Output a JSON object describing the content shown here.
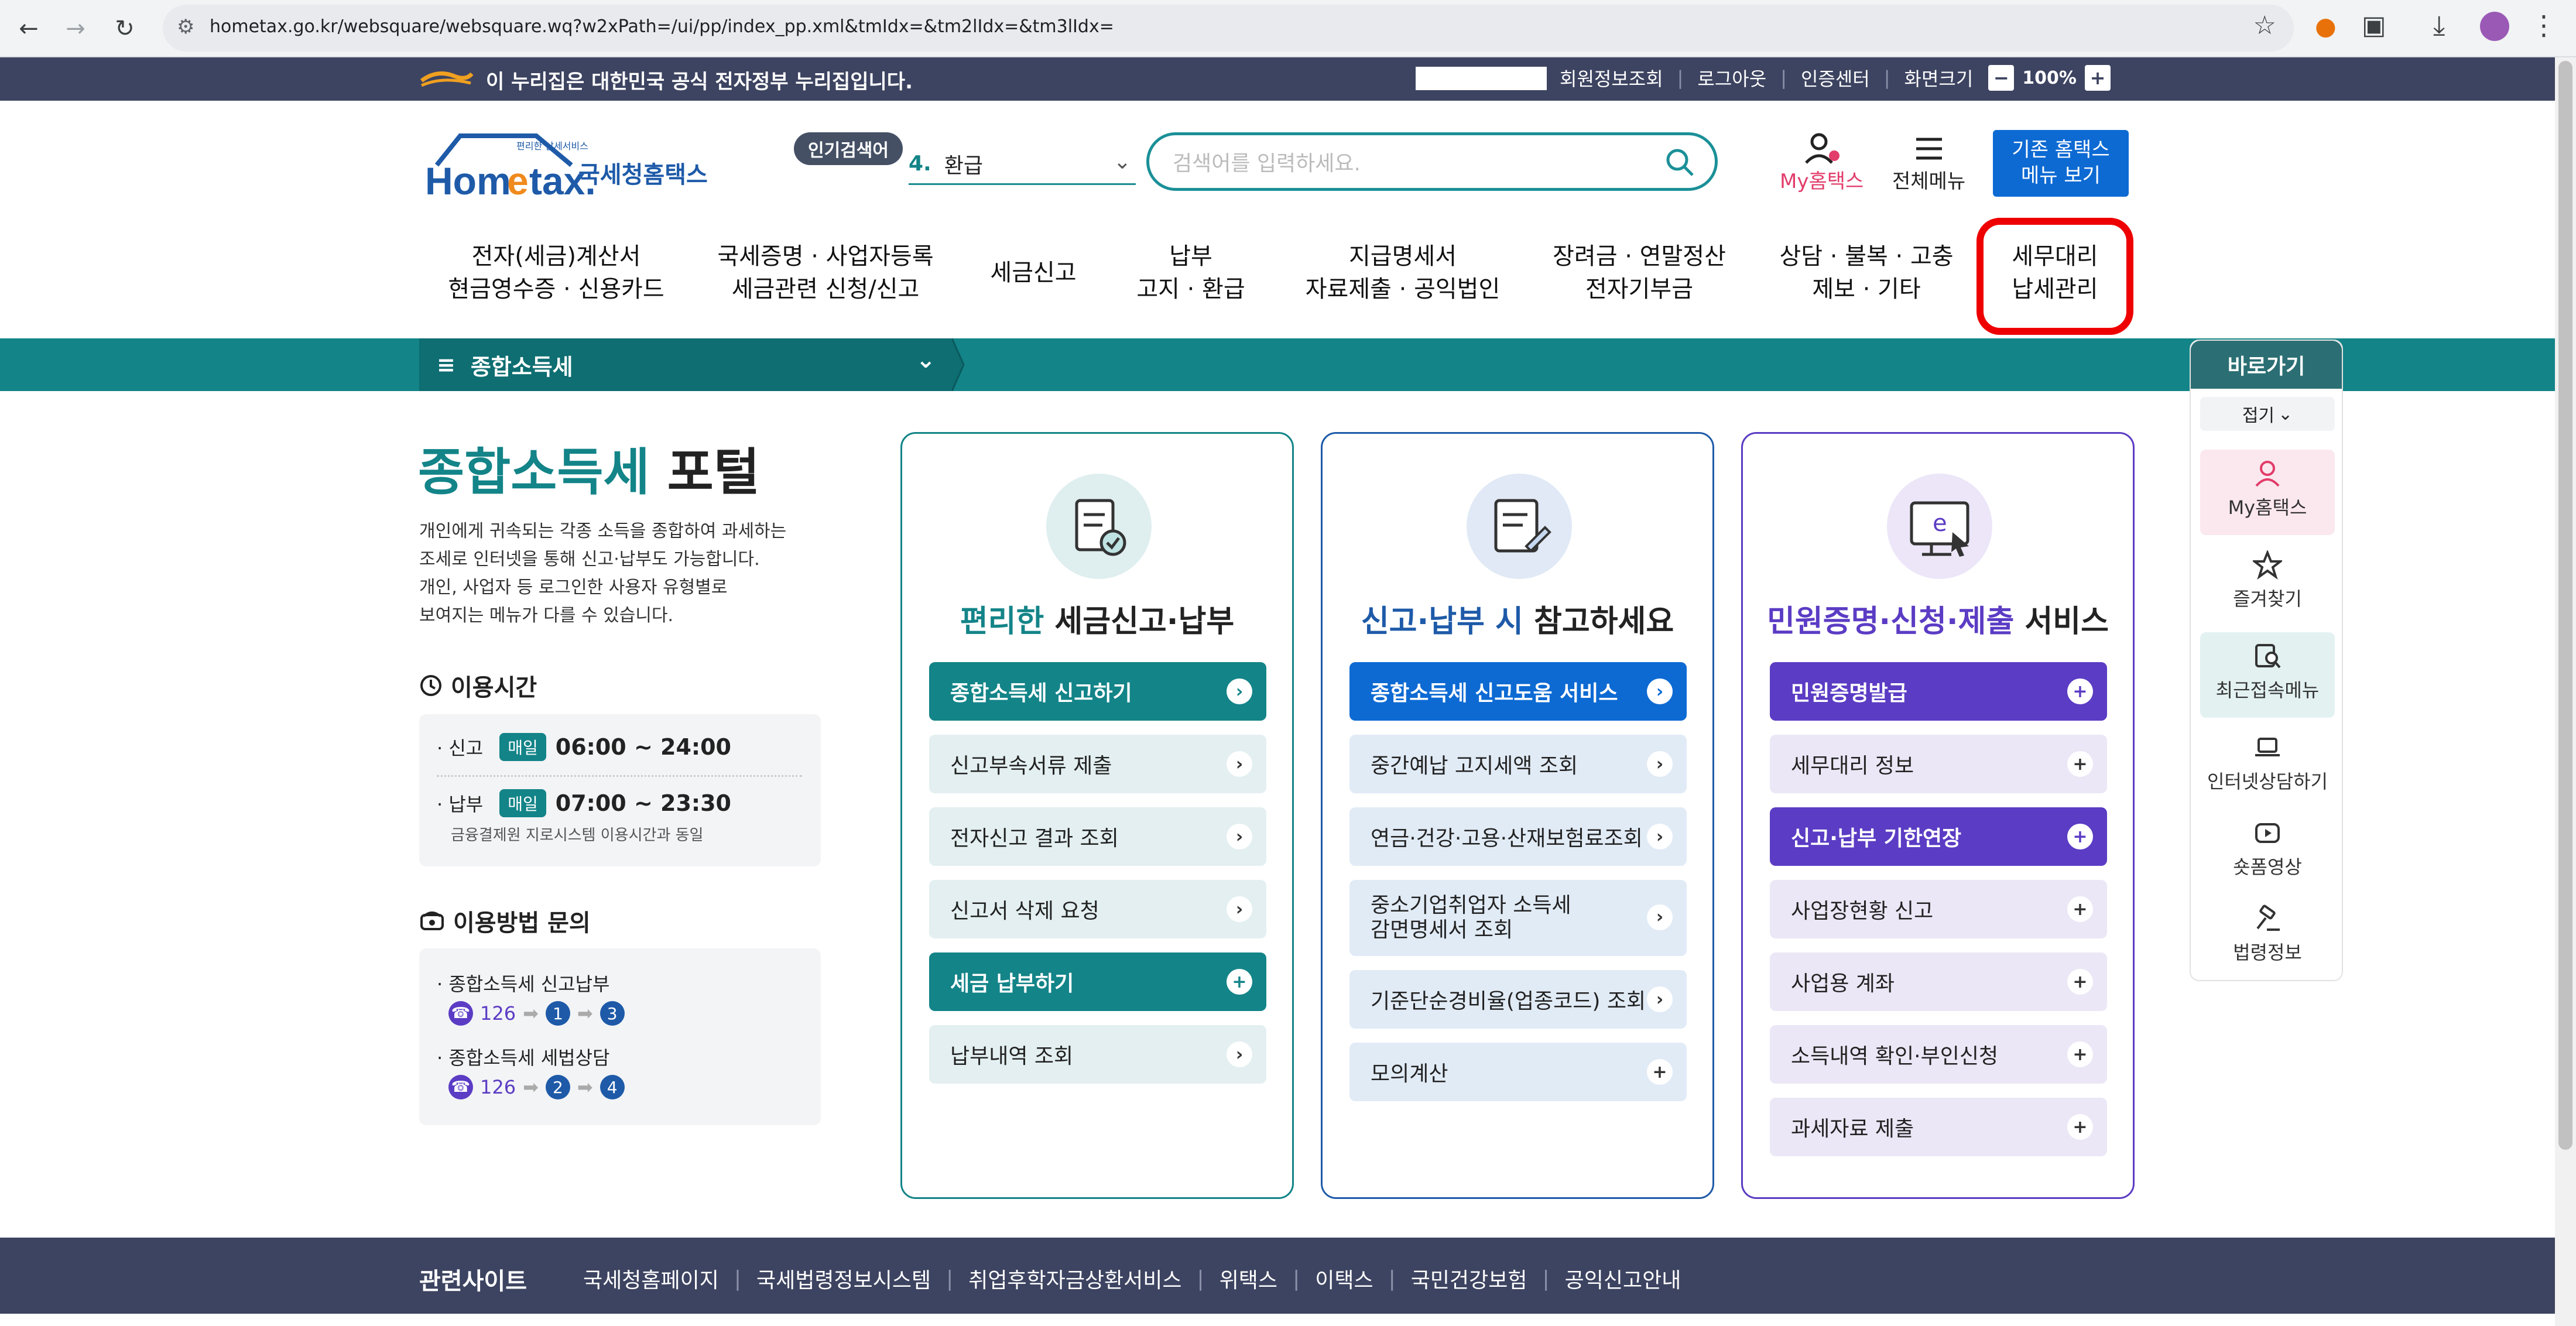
{
  "browser": {
    "url": "hometax.go.kr/websquare/websquare.wq?w2xPath=/ui/pp/index_pp.xml&tmIdx=&tm2lIdx=&tm3lIdx="
  },
  "gov_banner": {
    "text": "이 누리집은 대한민국 공식 전자정부 누리집입니다.",
    "links": [
      "회원정보조회",
      "로그아웃",
      "인증센터",
      "화면크기"
    ],
    "zoom": "100%"
  },
  "header": {
    "logo_text": "Hometax",
    "logo_small": "편리한 납세서비스",
    "logo_label": "국세청홈택스",
    "popular_tag": "인기검색어",
    "popular_rank": "4.",
    "popular_term": "환급",
    "search_placeholder": "검색어를 입력하세요.",
    "my_hometax": "My홈택스",
    "all_menu": "전체메뉴",
    "old_hometax_line1": "기존 홈택스",
    "old_hometax_line2": "메뉴 보기"
  },
  "gnb": [
    {
      "l1": "전자(세금)계산서",
      "l2": "현금영수증 · 신용카드"
    },
    {
      "l1": "국세증명 · 사업자등록",
      "l2": "세금관련 신청/신고"
    },
    {
      "l1": "세금신고",
      "l2": ""
    },
    {
      "l1": "납부",
      "l2": "고지 · 환급"
    },
    {
      "l1": "지급명세서",
      "l2": "자료제출 · 공익법인"
    },
    {
      "l1": "장려금 · 연말정산",
      "l2": "전자기부금"
    },
    {
      "l1": "상담 · 불복 · 고충",
      "l2": "제보 · 기타"
    },
    {
      "l1": "세무대리",
      "l2": "납세관리"
    }
  ],
  "breadcrumb": {
    "label": "종합소득세"
  },
  "left": {
    "title_a": "종합소득세",
    "title_b": "포털",
    "desc": [
      "개인에게 귀속되는 각종 소득을 종합하여 과세하는",
      "조세로 인터넷을 통해 신고·납부도 가능합니다.",
      "개인, 사업자 등 로그인한 사용자 유형별로",
      "보여지는 메뉴가 다를 수 있습니다."
    ],
    "hours_title": "이용시간",
    "hours": [
      {
        "label": "· 신고",
        "badge": "매일",
        "time": "06:00 ~ 24:00"
      },
      {
        "label": "· 납부",
        "badge": "매일",
        "time": "07:00 ~ 23:30"
      }
    ],
    "hours_note": "금융결제원 지로시스템 이용시간과 동일",
    "contact_title": "이용방법 문의",
    "contacts": [
      {
        "label": "· 종합소득세 신고납부",
        "num": "126",
        "s1": "1",
        "s2": "3"
      },
      {
        "label": "· 종합소득세 세법상담",
        "num": "126",
        "s1": "2",
        "s2": "4"
      }
    ]
  },
  "columns": [
    {
      "title_hl": "편리한",
      "title_rest": " 세금신고·납부",
      "items": [
        {
          "label": "종합소득세 신고하기",
          "type": "primary",
          "icon": "chevron-right"
        },
        {
          "label": "신고부속서류 제출",
          "type": "sub",
          "icon": "chevron-right"
        },
        {
          "label": "전자신고 결과 조회",
          "type": "sub",
          "icon": "chevron-right"
        },
        {
          "label": "신고서 삭제 요청",
          "type": "sub",
          "icon": "chevron-right"
        },
        {
          "label": "세금 납부하기",
          "type": "primary",
          "icon": "plus"
        },
        {
          "label": "납부내역 조회",
          "type": "sub",
          "icon": "chevron-right"
        }
      ]
    },
    {
      "title_hl": "신고·납부 시",
      "title_rest": " 참고하세요",
      "items": [
        {
          "label": "종합소득세 신고도움 서비스",
          "type": "primary",
          "icon": "chevron-right"
        },
        {
          "label": "중간예납 고지세액 조회",
          "type": "sub",
          "icon": "chevron-right"
        },
        {
          "label": "연금·건강·고용·산재보험료조회",
          "type": "sub",
          "icon": "chevron-right"
        },
        {
          "label": "중소기업취업자 소득세\n감면명세서 조회",
          "type": "sub",
          "icon": "chevron-right"
        },
        {
          "label": "기준단순경비율(업종코드) 조회",
          "type": "sub",
          "icon": "chevron-right"
        },
        {
          "label": "모의계산",
          "type": "sub",
          "icon": "plus"
        }
      ]
    },
    {
      "title_hl": "민원증명·신청·제출",
      "title_rest": " 서비스",
      "items": [
        {
          "label": "민원증명발급",
          "type": "primary",
          "icon": "plus"
        },
        {
          "label": "세무대리 정보",
          "type": "sub",
          "icon": "plus"
        },
        {
          "label": "신고·납부 기한연장",
          "type": "primary",
          "icon": "plus"
        },
        {
          "label": "사업장현황 신고",
          "type": "sub",
          "icon": "plus"
        },
        {
          "label": "사업용 계좌",
          "type": "sub",
          "icon": "plus"
        },
        {
          "label": "소득내역 확인·부인신청",
          "type": "sub",
          "icon": "plus"
        },
        {
          "label": "과세자료 제출",
          "type": "sub",
          "icon": "plus"
        }
      ]
    }
  ],
  "quick": {
    "title": "바로가기",
    "fold": "접기",
    "items": [
      "My홈택스",
      "즐겨찾기",
      "최근접속메뉴",
      "인터넷상담하기",
      "숏폼영상",
      "법령정보"
    ]
  },
  "footer": {
    "title": "관련사이트",
    "links": [
      "국세청홈페이지",
      "국세법령정보시스템",
      "취업후학자금상환서비스",
      "위택스",
      "이택스",
      "국민건강보험",
      "공익신고안내"
    ]
  },
  "colors": {
    "teal": "#138488",
    "blue": "#0d6ad3",
    "purple": "#5b3cc4",
    "gov": "#3d4461"
  }
}
